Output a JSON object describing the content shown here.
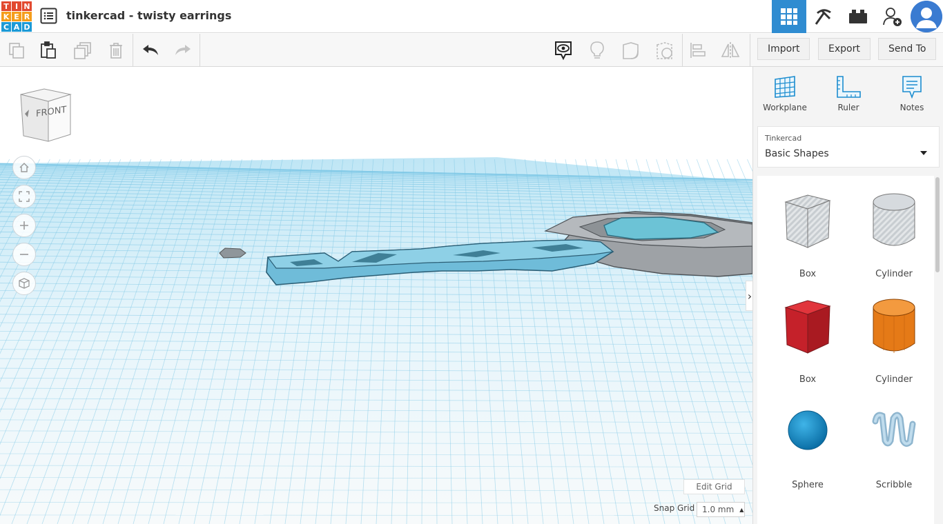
{
  "app": {
    "logo_letters": [
      "T",
      "I",
      "N",
      "K",
      "E",
      "R",
      "C",
      "A",
      "D"
    ],
    "logo_colors": [
      "#e2492f",
      "#e2492f",
      "#e2492f",
      "#f59d1b",
      "#f59d1b",
      "#f59d1b",
      "#1c9ad6",
      "#1c9ad6",
      "#1c9ad6"
    ],
    "doc_title": "tinkercad - twisty earrings"
  },
  "topbar": {
    "buttons": [
      {
        "name": "3d-design-view",
        "icon": "grid-icon",
        "active": true
      },
      {
        "name": "codeblocks",
        "icon": "pickaxe-icon",
        "active": false
      },
      {
        "name": "bricks",
        "icon": "brick-icon",
        "active": false
      },
      {
        "name": "invite-user",
        "icon": "add-user-icon",
        "active": false
      }
    ],
    "avatar_icon": "user-avatar-icon"
  },
  "toolbar": {
    "copy_icon": "copy-icon",
    "paste_icon": "paste-icon",
    "duplicate_icon": "duplicate-icon",
    "delete_icon": "trash-icon",
    "undo_icon": "undo-icon",
    "redo_icon": "redo-icon",
    "notes_toggle_icon": "eye-bubble-icon",
    "hint_icon": "lightbulb-icon",
    "shape_icon": "solid-shape-icon",
    "hole_icon": "hole-shape-icon",
    "align_icon": "align-icon",
    "mirror_icon": "mirror-icon",
    "import_label": "Import",
    "export_label": "Export",
    "send_label": "Send To"
  },
  "workspace": {
    "viewcube_label": "FRONT",
    "nav": [
      "home-icon",
      "fit-icon",
      "zoom-in-icon",
      "zoom-out-icon",
      "perspective-icon"
    ],
    "edit_grid_label": "Edit Grid",
    "snap_grid_label": "Snap Grid",
    "snap_grid_value": "1.0 mm",
    "grid_color": "#7fc8e6",
    "model_color": "#6fbcd9",
    "holder_color": "#9ea2a6"
  },
  "panel": {
    "tools": [
      {
        "label": "Workplane",
        "icon": "workplane-icon"
      },
      {
        "label": "Ruler",
        "icon": "ruler-icon"
      },
      {
        "label": "Notes",
        "icon": "notes-icon"
      }
    ],
    "library_category": "Tinkercad",
    "library_name": "Basic Shapes",
    "shapes": [
      {
        "label": "Box",
        "icon": "box-hole-icon"
      },
      {
        "label": "Cylinder",
        "icon": "cylinder-hole-icon"
      },
      {
        "label": "Box",
        "icon": "box-red-icon"
      },
      {
        "label": "Cylinder",
        "icon": "cylinder-orange-icon"
      },
      {
        "label": "Sphere",
        "icon": "sphere-icon"
      },
      {
        "label": "Scribble",
        "icon": "scribble-icon"
      }
    ]
  }
}
